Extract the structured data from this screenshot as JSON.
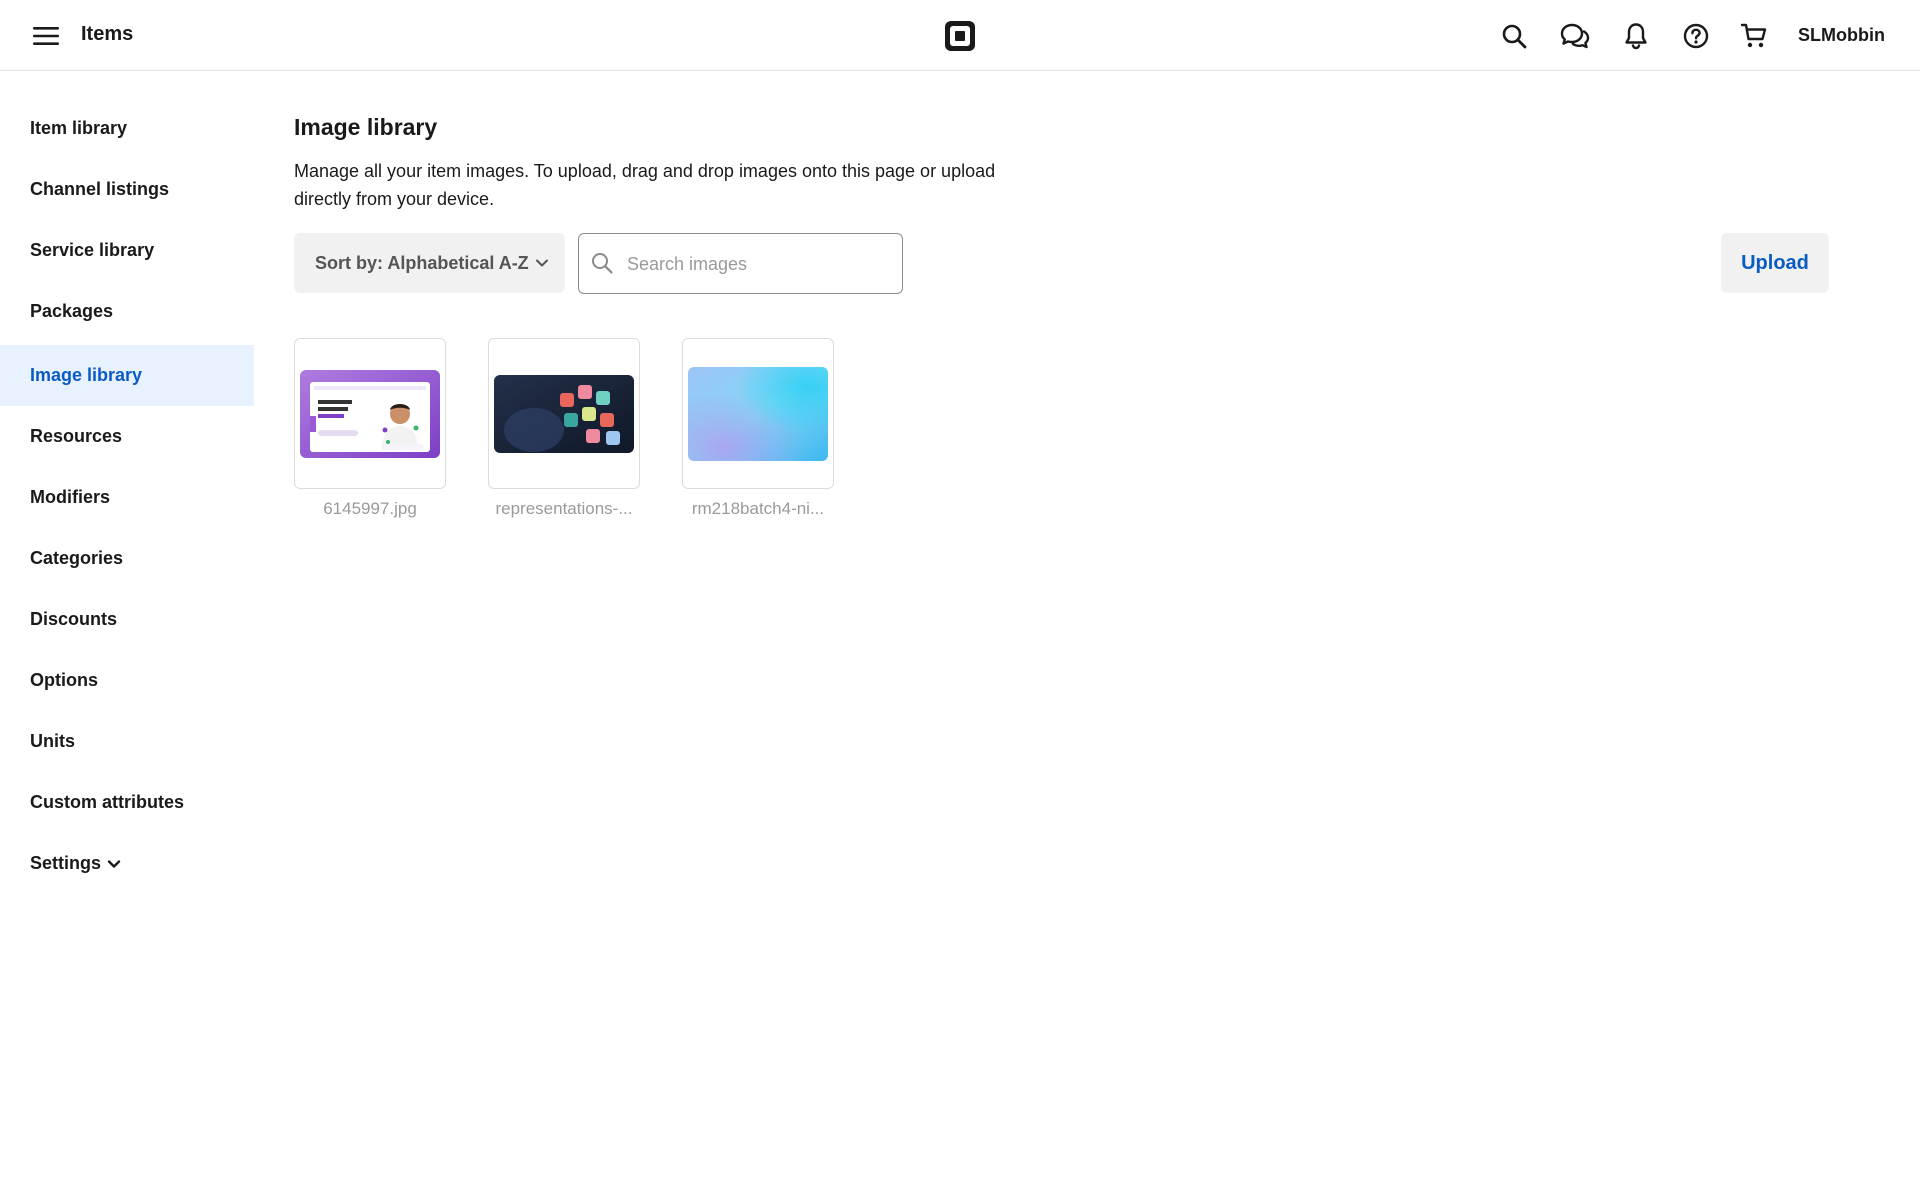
{
  "header": {
    "title": "Items",
    "user_name": "SLMobbin",
    "icons": [
      "menu-icon",
      "square-logo-icon",
      "search-icon",
      "messages-icon",
      "bell-icon",
      "help-icon",
      "cart-icon"
    ]
  },
  "sidebar": {
    "items": [
      {
        "label": "Item library",
        "active": false
      },
      {
        "label": "Channel listings",
        "active": false
      },
      {
        "label": "Service library",
        "active": false
      },
      {
        "label": "Packages",
        "active": false
      },
      {
        "label": "Image library",
        "active": true
      },
      {
        "label": "Resources",
        "active": false
      },
      {
        "label": "Modifiers",
        "active": false
      },
      {
        "label": "Categories",
        "active": false
      },
      {
        "label": "Discounts",
        "active": false
      },
      {
        "label": "Options",
        "active": false
      },
      {
        "label": "Units",
        "active": false
      },
      {
        "label": "Custom attributes",
        "active": false
      },
      {
        "label": "Settings",
        "active": false
      }
    ]
  },
  "main": {
    "title": "Image library",
    "description": "Manage all your item images. To upload, drag and drop images onto this page or upload directly from your device.",
    "sort_label": "Sort by: Alphabetical A-Z",
    "search_placeholder": "Search images",
    "search_value": "",
    "upload_label": "Upload",
    "images": [
      {
        "name": "6145997.jpg"
      },
      {
        "name": "representations-..."
      },
      {
        "name": "rm218batch4-ni..."
      }
    ]
  },
  "colors": {
    "accent": "#0a5bc4",
    "active_bg": "#e8f1fe",
    "text": "#1a1a1a",
    "muted": "#9a9a9a",
    "button_bg": "#f1f1f1"
  }
}
